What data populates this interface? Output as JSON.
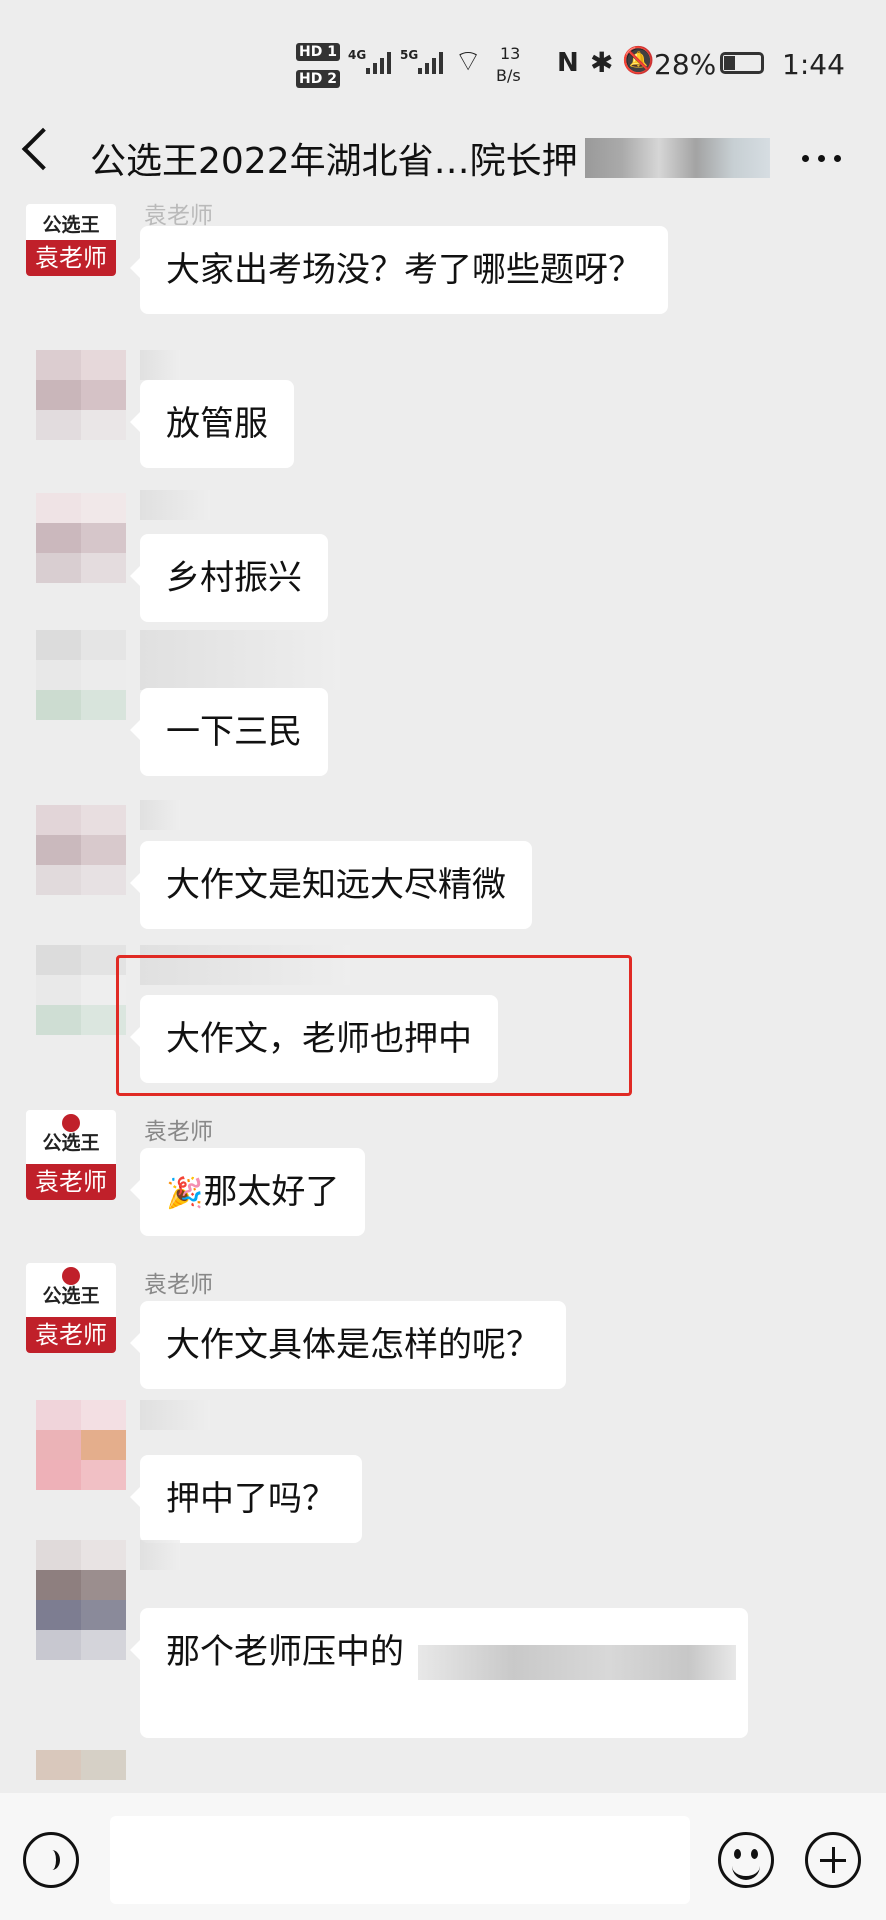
{
  "status_bar": {
    "hd1": "HD 1",
    "hd2": "HD 2",
    "net1": "4G",
    "net2": "5G",
    "speed_value": "13",
    "speed_unit": "B/s",
    "nfc": "N",
    "bluetooth": "✱",
    "battery": "28%",
    "time": "1:44"
  },
  "header": {
    "back_icon": "back-chevron-icon",
    "title": "公选王2022年湖北省…院长押",
    "more_icon": "more-dots-icon"
  },
  "avatar_brand": {
    "name": "公选王",
    "tag": "袁老师",
    "brand_color": "#c0202a"
  },
  "messages": [
    {
      "sender": "袁老师",
      "text": "大家出考场没？考了哪些题呀？"
    },
    {
      "sender": "",
      "text": "放管服"
    },
    {
      "sender": "",
      "text": "乡村振兴"
    },
    {
      "sender": "",
      "text": "一下三民"
    },
    {
      "sender": "",
      "text": "大作文是知远大尽精微"
    },
    {
      "sender": "",
      "text": "大作文，老师也押中"
    },
    {
      "sender": "袁老师",
      "emoji": "🎉",
      "text": "那太好了"
    },
    {
      "sender": "袁老师",
      "text": "大作文具体是怎样的呢？"
    },
    {
      "sender": "",
      "text": "押中了吗？"
    },
    {
      "sender": "",
      "text": "那个老师压中的"
    }
  ],
  "highlight_color": "#e02a24",
  "input_bar": {
    "voice_icon": "voice-icon",
    "emoji_icon": "emoji-icon",
    "plus_icon": "plus-icon"
  }
}
